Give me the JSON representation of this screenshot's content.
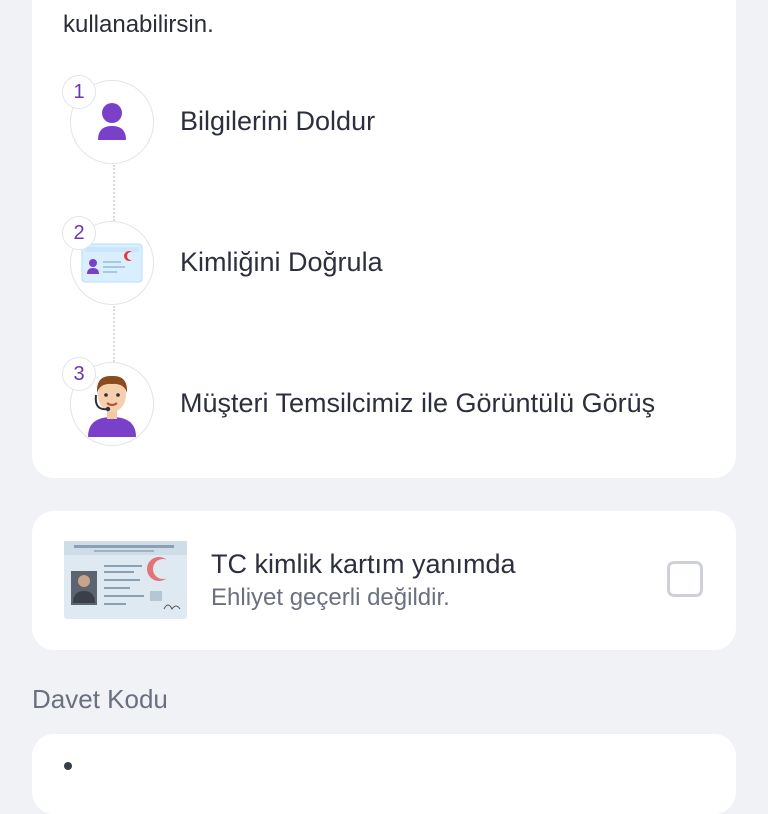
{
  "intro_text": "kullanabilirsin.",
  "steps": [
    {
      "number": "1",
      "label": "Bilgilerini Doldur",
      "icon": "user-icon"
    },
    {
      "number": "2",
      "label": "Kimliğini Doğrula",
      "icon": "id-card-icon"
    },
    {
      "number": "3",
      "label": "Müşteri Temsilcimiz ile Görüntülü Görüş",
      "icon": "agent-icon"
    }
  ],
  "id_option": {
    "title": "TC kimlik kartım yanımda",
    "subtitle": "Ehliyet geçerli değildir.",
    "checked": false
  },
  "invite": {
    "label": "Davet Kodu"
  },
  "colors": {
    "accent": "#6a35b8",
    "background": "#f1f2f5",
    "card": "#ffffff"
  }
}
